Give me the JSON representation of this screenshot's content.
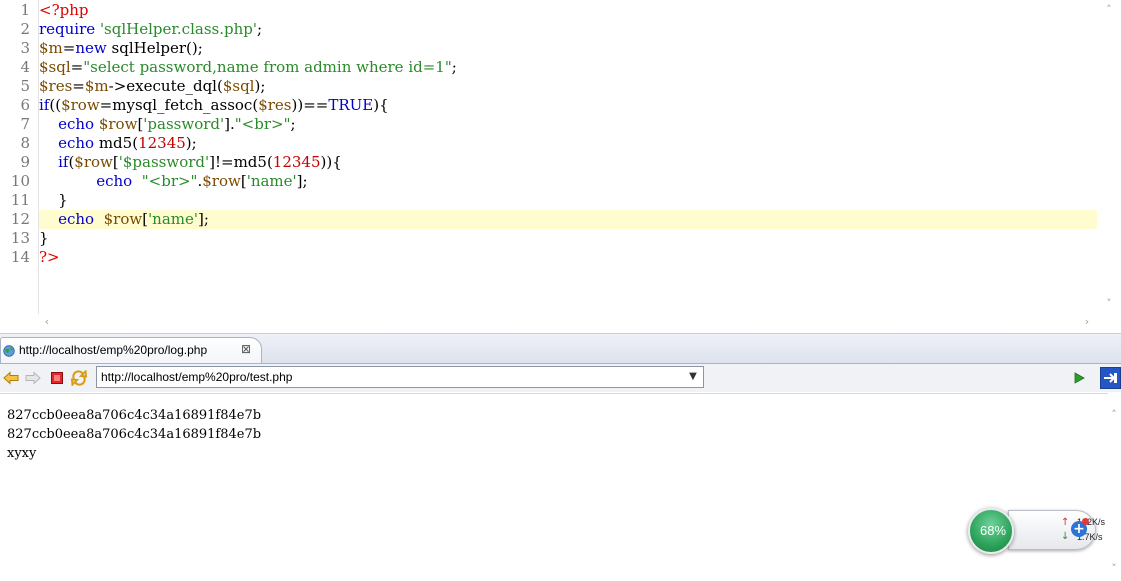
{
  "editor": {
    "lines": [
      {
        "num": "1",
        "tokens": [
          {
            "t": "<?php",
            "c": "tag"
          }
        ]
      },
      {
        "num": "2",
        "tokens": [
          {
            "t": "require",
            "c": "kw"
          },
          {
            "t": " ",
            "c": "plain"
          },
          {
            "t": "'sqlHelper.class.php'",
            "c": "str"
          },
          {
            "t": ";",
            "c": "plain"
          }
        ]
      },
      {
        "num": "3",
        "tokens": [
          {
            "t": "$m",
            "c": "var"
          },
          {
            "t": "=",
            "c": "plain"
          },
          {
            "t": "new",
            "c": "kw"
          },
          {
            "t": " sqlHelper();",
            "c": "plain"
          }
        ]
      },
      {
        "num": "4",
        "tokens": [
          {
            "t": "$sql",
            "c": "var"
          },
          {
            "t": "=",
            "c": "plain"
          },
          {
            "t": "\"select password,name from admin where id=1\"",
            "c": "str"
          },
          {
            "t": ";",
            "c": "plain"
          }
        ]
      },
      {
        "num": "5",
        "tokens": [
          {
            "t": "$res",
            "c": "var"
          },
          {
            "t": "=",
            "c": "plain"
          },
          {
            "t": "$m",
            "c": "var"
          },
          {
            "t": "->execute_dql(",
            "c": "plain"
          },
          {
            "t": "$sql",
            "c": "var"
          },
          {
            "t": ");",
            "c": "plain"
          }
        ]
      },
      {
        "num": "6",
        "tokens": [
          {
            "t": "if",
            "c": "kw"
          },
          {
            "t": "((",
            "c": "plain"
          },
          {
            "t": "$row",
            "c": "var"
          },
          {
            "t": "=mysql_fetch_assoc(",
            "c": "plain"
          },
          {
            "t": "$res",
            "c": "var"
          },
          {
            "t": "))==",
            "c": "plain"
          },
          {
            "t": "TRUE",
            "c": "kw"
          },
          {
            "t": "){",
            "c": "plain"
          }
        ]
      },
      {
        "num": "7",
        "tokens": [
          {
            "t": "    ",
            "c": "plain"
          },
          {
            "t": "echo",
            "c": "kw"
          },
          {
            "t": " ",
            "c": "plain"
          },
          {
            "t": "$row",
            "c": "var"
          },
          {
            "t": "[",
            "c": "plain"
          },
          {
            "t": "'password'",
            "c": "str"
          },
          {
            "t": "].",
            "c": "plain"
          },
          {
            "t": "\"<br>\"",
            "c": "str"
          },
          {
            "t": ";",
            "c": "plain"
          }
        ]
      },
      {
        "num": "8",
        "tokens": [
          {
            "t": "    ",
            "c": "plain"
          },
          {
            "t": "echo",
            "c": "kw"
          },
          {
            "t": " md5(",
            "c": "plain"
          },
          {
            "t": "12345",
            "c": "num"
          },
          {
            "t": ");",
            "c": "plain"
          }
        ]
      },
      {
        "num": "9",
        "tokens": [
          {
            "t": "    ",
            "c": "plain"
          },
          {
            "t": "if",
            "c": "kw"
          },
          {
            "t": "(",
            "c": "plain"
          },
          {
            "t": "$row",
            "c": "var"
          },
          {
            "t": "[",
            "c": "plain"
          },
          {
            "t": "'$password'",
            "c": "str"
          },
          {
            "t": "]!=md5(",
            "c": "plain"
          },
          {
            "t": "12345",
            "c": "num"
          },
          {
            "t": ")){",
            "c": "plain"
          }
        ]
      },
      {
        "num": "10",
        "tokens": [
          {
            "t": "            ",
            "c": "plain"
          },
          {
            "t": "echo",
            "c": "kw"
          },
          {
            "t": "  ",
            "c": "plain"
          },
          {
            "t": "\"<br>\"",
            "c": "str"
          },
          {
            "t": ".",
            "c": "plain"
          },
          {
            "t": "$row",
            "c": "var"
          },
          {
            "t": "[",
            "c": "plain"
          },
          {
            "t": "'name'",
            "c": "str"
          },
          {
            "t": "];",
            "c": "plain"
          }
        ]
      },
      {
        "num": "11",
        "tokens": [
          {
            "t": "    }",
            "c": "plain"
          }
        ]
      },
      {
        "num": "12",
        "tokens": [
          {
            "t": "    ",
            "c": "plain"
          },
          {
            "t": "echo",
            "c": "kw"
          },
          {
            "t": "  ",
            "c": "plain"
          },
          {
            "t": "$row",
            "c": "var"
          },
          {
            "t": "[",
            "c": "plain"
          },
          {
            "t": "'name'",
            "c": "str"
          },
          {
            "t": "];",
            "c": "plain"
          }
        ],
        "current": true
      },
      {
        "num": "13",
        "tokens": [
          {
            "t": "}",
            "c": "plain"
          }
        ]
      },
      {
        "num": "14",
        "tokens": [
          {
            "t": "?>",
            "c": "tag"
          }
        ]
      }
    ]
  },
  "browser": {
    "tab_label": "http://localhost/emp%20pro/log.php",
    "tab_close_glyph": "⊠",
    "url": "http://localhost/emp%20pro/test.php",
    "page_lines": [
      "827ccb0eea8a706c4c34a16891f84e7b",
      "827ccb0eea8a706c4c34a16891f84e7b",
      "xyxy"
    ]
  },
  "net_widget": {
    "percent": "68%",
    "upload": "122K/s",
    "download": "1.7K/s"
  },
  "colors": {
    "tag": "#e00000",
    "keyword": "#0000c8",
    "variable": "#7a4b00",
    "string": "#2a8a2a",
    "number": "#c80000",
    "current_line": "#fffdd0"
  }
}
